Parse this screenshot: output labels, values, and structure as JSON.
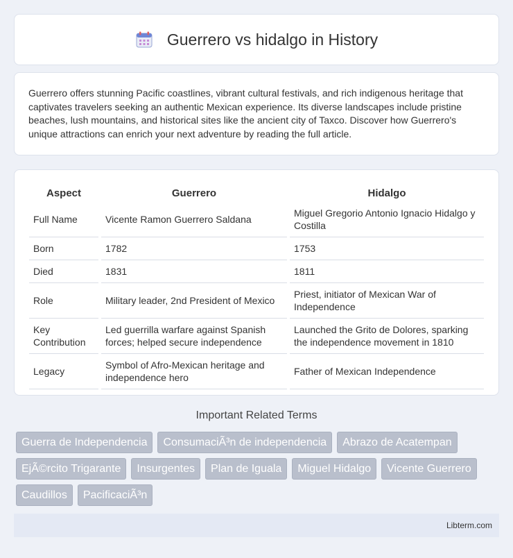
{
  "header": {
    "title": "Guerrero vs hidalgo in History",
    "icon": "calendar-icon"
  },
  "intro": {
    "text": "Guerrero offers stunning Pacific coastlines, vibrant cultural festivals, and rich indigenous heritage that captivates travelers seeking an authentic Mexican experience. Its diverse landscapes include pristine beaches, lush mountains, and historical sites like the ancient city of Taxco. Discover how Guerrero's unique attractions can enrich your next adventure by reading the full article."
  },
  "table": {
    "headers": [
      "Aspect",
      "Guerrero",
      "Hidalgo"
    ],
    "rows": [
      [
        "Full Name",
        "Vicente Ramon Guerrero Saldana",
        "Miguel Gregorio Antonio Ignacio Hidalgo y Costilla"
      ],
      [
        "Born",
        "1782",
        "1753"
      ],
      [
        "Died",
        "1831",
        "1811"
      ],
      [
        "Role",
        "Military leader, 2nd President of Mexico",
        "Priest, initiator of Mexican War of Independence"
      ],
      [
        "Key Contribution",
        "Led guerrilla warfare against Spanish forces; helped secure independence",
        "Launched the Grito de Dolores, sparking the independence movement in 1810"
      ],
      [
        "Legacy",
        "Symbol of Afro-Mexican heritage and independence hero",
        "Father of Mexican Independence"
      ]
    ]
  },
  "related": {
    "title": "Important Related Terms",
    "tags": [
      "Guerra de Independencia",
      "ConsumaciÃ³n de independencia",
      "Abrazo de Acatempan",
      "EjÃ©rcito Trigarante",
      "Insurgentes",
      "Plan de Iguala",
      "Miguel Hidalgo",
      "Vicente Guerrero",
      "Caudillos",
      "PacificaciÃ³n"
    ]
  },
  "footer": {
    "brand": "Libterm.com"
  },
  "colors": {
    "background": "#eef1f7",
    "tag_bg": "#b9bfcc",
    "footer_bg": "#e4e9f4"
  }
}
